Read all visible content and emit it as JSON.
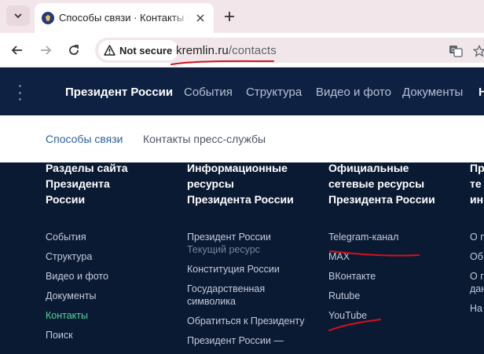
{
  "browser": {
    "tab_title": "Способы связи · Контакты · Президент России",
    "secure_label": "Not secure",
    "url_domain": "kremlin.ru",
    "url_path": "/contacts"
  },
  "site_nav": {
    "brand": "Президент России",
    "items": [
      "События",
      "Структура",
      "Видео и фото",
      "Документы",
      "Н"
    ]
  },
  "subnav": {
    "items": [
      "Способы связи",
      "Контакты пресс-службы"
    ]
  },
  "columns": [
    {
      "heading": "Разделы сайта\nПрезидента\nРоссии",
      "links": [
        "События",
        "Структура",
        "Видео и фото",
        "Документы",
        "Контакты",
        "Поиск"
      ]
    },
    {
      "heading": "Информационные\nресурсы\nПрезидента России",
      "links": [
        "Президент России",
        "Текущий ресурс",
        "Конституция России",
        "Государственная",
        "символика",
        "Обратиться к Президенту",
        "Президент России —"
      ]
    },
    {
      "heading": "Официальные\nсетевые ресурсы\nПрезидента России",
      "links": [
        "Telegram-канал",
        "MAX",
        "ВКонтакте",
        "Rutube",
        "YouTube"
      ]
    },
    {
      "heading": "Пр\nте\nин",
      "links": [
        "О п",
        "Об",
        "О г",
        "дан",
        "На"
      ]
    }
  ],
  "colors": {
    "nav_bg": "#0f2142",
    "content_bg": "#0b1a33",
    "active_link": "#52d69a",
    "subnav_active": "#2b5f9e",
    "annotation": "#d4101c"
  }
}
